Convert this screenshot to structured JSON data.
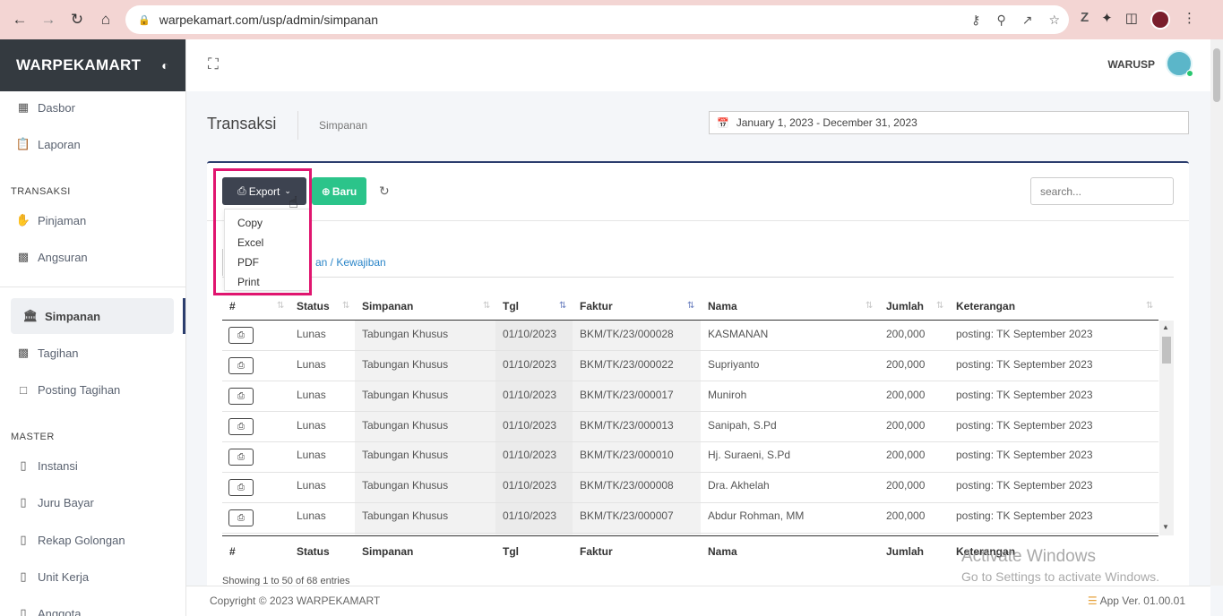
{
  "browser": {
    "url": "warpekamart.com/usp/admin/simpanan",
    "back_icon": "arrow-left-icon",
    "forward_icon": "arrow-right-icon",
    "reload_icon": "reload-icon",
    "home_icon": "home-icon"
  },
  "sidebar": {
    "brand": "WARPEKAMART",
    "items_top": [
      {
        "label": "Dasbor",
        "icon": "dashboard-icon"
      },
      {
        "label": "Laporan",
        "icon": "report-icon"
      }
    ],
    "section_transaksi": "TRANSAKSI",
    "items_transaksi": [
      {
        "label": "Pinjaman",
        "icon": "hand-icon"
      },
      {
        "label": "Angsuran",
        "icon": "money-icon"
      }
    ],
    "active_item": "Simpanan",
    "items_mid": [
      {
        "label": "Tagihan",
        "icon": "money-icon"
      },
      {
        "label": "Posting Tagihan",
        "icon": "note-icon"
      }
    ],
    "section_master": "MASTER",
    "items_master": [
      {
        "label": "Instansi",
        "icon": "book-icon"
      },
      {
        "label": "Juru Bayar",
        "icon": "book-icon"
      },
      {
        "label": "Rekap Golongan",
        "icon": "book-icon"
      },
      {
        "label": "Unit Kerja",
        "icon": "book-icon"
      },
      {
        "label": "Anggota",
        "icon": "book-icon"
      }
    ]
  },
  "topbar": {
    "user": "WARUSP"
  },
  "page": {
    "title": "Transaksi",
    "breadcrumb": "Simpanan",
    "date_range": "January 1, 2023 - December 31, 2023"
  },
  "toolbar": {
    "export_label": "Export",
    "new_label": "Baru",
    "search_placeholder": "search..."
  },
  "export_menu": [
    "Copy",
    "Excel",
    "PDF",
    "Print"
  ],
  "tab_label": "an / Kewajiban",
  "table": {
    "columns": [
      "#",
      "Status",
      "Simpanan",
      "Tgl",
      "Faktur",
      "Nama",
      "Jumlah",
      "Keterangan"
    ],
    "rows": [
      {
        "status": "Lunas",
        "simpanan": "Tabungan Khusus",
        "tgl": "01/10/2023",
        "faktur": "BKM/TK/23/000028",
        "nama": "KASMANAN",
        "jumlah": "200,000",
        "keterangan": "posting: TK September 2023"
      },
      {
        "status": "Lunas",
        "simpanan": "Tabungan Khusus",
        "tgl": "01/10/2023",
        "faktur": "BKM/TK/23/000022",
        "nama": "Supriyanto",
        "jumlah": "200,000",
        "keterangan": "posting: TK September 2023"
      },
      {
        "status": "Lunas",
        "simpanan": "Tabungan Khusus",
        "tgl": "01/10/2023",
        "faktur": "BKM/TK/23/000017",
        "nama": "Muniroh",
        "jumlah": "200,000",
        "keterangan": "posting: TK September 2023"
      },
      {
        "status": "Lunas",
        "simpanan": "Tabungan Khusus",
        "tgl": "01/10/2023",
        "faktur": "BKM/TK/23/000013",
        "nama": "Sanipah, S.Pd",
        "jumlah": "200,000",
        "keterangan": "posting: TK September 2023"
      },
      {
        "status": "Lunas",
        "simpanan": "Tabungan Khusus",
        "tgl": "01/10/2023",
        "faktur": "BKM/TK/23/000010",
        "nama": "Hj. Suraeni, S.Pd",
        "jumlah": "200,000",
        "keterangan": "posting: TK September 2023"
      },
      {
        "status": "Lunas",
        "simpanan": "Tabungan Khusus",
        "tgl": "01/10/2023",
        "faktur": "BKM/TK/23/000008",
        "nama": "Dra. Akhelah",
        "jumlah": "200,000",
        "keterangan": "posting: TK September 2023"
      },
      {
        "status": "Lunas",
        "simpanan": "Tabungan Khusus",
        "tgl": "01/10/2023",
        "faktur": "BKM/TK/23/000007",
        "nama": "Abdur Rohman, MM",
        "jumlah": "200,000",
        "keterangan": "posting: TK September 2023"
      }
    ],
    "info": "Showing 1 to 50 of 68 entries"
  },
  "watermark": {
    "line1": "Activate Windows",
    "line2": "Go to Settings to activate Windows."
  },
  "footer": {
    "copyright": "Copyright © 2023 WARPEKAMART",
    "version": "App Ver. 01.00.01"
  },
  "colors": {
    "browser_bar": "#f3d5d3",
    "brand_bg": "#343a40",
    "accent": "#2b3d6e",
    "new_button": "#2bc48a",
    "highlight": "#e0156f",
    "link": "#2a85c8"
  }
}
